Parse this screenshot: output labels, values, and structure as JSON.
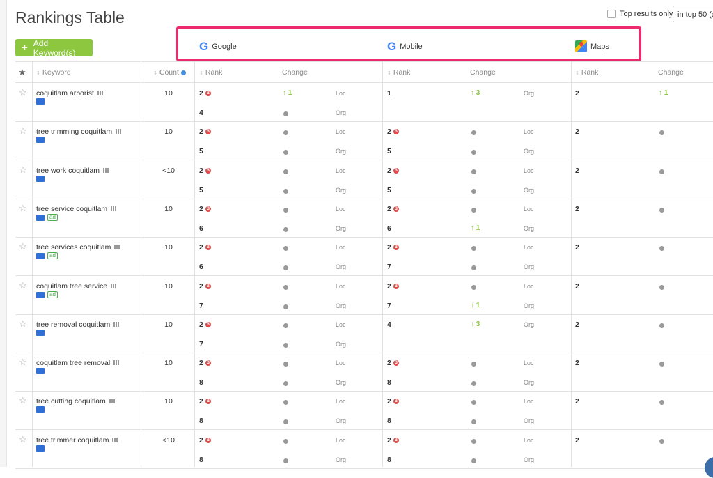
{
  "page": {
    "title": "Rankings Table",
    "top_results_label": "Top results only",
    "top_select_value": "in top 50 (al",
    "add_button_label": "Add Keyword(s)"
  },
  "engines": [
    {
      "name": "Google",
      "icon": "google-icon"
    },
    {
      "name": "Mobile",
      "icon": "google-icon"
    },
    {
      "name": "Maps",
      "icon": "google-maps-icon"
    }
  ],
  "headers": {
    "keyword": "Keyword",
    "count": "Count",
    "rank": "Rank",
    "change": "Change"
  },
  "colors": {
    "accent_green": "#8dc63f",
    "highlight": "#ee2a6e",
    "badge_red": "#e04b4b"
  },
  "rows": [
    {
      "keyword": "coquitlam arborist",
      "count": "10",
      "ad": "",
      "g_rank_loc": "2",
      "g_loc_badge": "B",
      "g_change_loc": "1",
      "g_type_loc": "Loc",
      "g_rank_org": "4",
      "g_type_org": "Org",
      "m_rank_1": "1",
      "m_change_1": "3",
      "m_type_1": "Org",
      "maps_rank": "2",
      "maps_change": "1"
    },
    {
      "keyword": "tree trimming coquitlam",
      "count": "10",
      "ad": "",
      "g_rank_loc": "2",
      "g_loc_badge": "B",
      "g_type_loc": "Loc",
      "g_rank_org": "5",
      "g_type_org": "Org",
      "m_rank_1": "2",
      "m_badge_1": "B",
      "m_type_1": "Loc",
      "m_rank_2": "5",
      "m_type_2": "Org",
      "maps_rank": "2"
    },
    {
      "keyword": "tree work coquitlam",
      "count": "<10",
      "ad": "",
      "g_rank_loc": "2",
      "g_loc_badge": "B",
      "g_type_loc": "Loc",
      "g_rank_org": "5",
      "g_type_org": "Org",
      "m_rank_1": "2",
      "m_badge_1": "B",
      "m_type_1": "Loc",
      "m_rank_2": "5",
      "m_type_2": "Org",
      "maps_rank": "2"
    },
    {
      "keyword": "tree service coquitlam",
      "count": "10",
      "ad": "ad",
      "g_rank_loc": "2",
      "g_loc_badge": "B",
      "g_type_loc": "Loc",
      "g_rank_org": "6",
      "g_type_org": "Org",
      "m_rank_1": "2",
      "m_badge_1": "B",
      "m_type_1": "Loc",
      "m_rank_2": "6",
      "m_change_2": "1",
      "m_type_2": "Org",
      "maps_rank": "2"
    },
    {
      "keyword": "tree services coquitlam",
      "count": "10",
      "ad": "ad",
      "g_rank_loc": "2",
      "g_loc_badge": "B",
      "g_type_loc": "Loc",
      "g_rank_org": "6",
      "g_type_org": "Org",
      "m_rank_1": "2",
      "m_badge_1": "B",
      "m_type_1": "Loc",
      "m_rank_2": "7",
      "m_type_2": "Org",
      "maps_rank": "2"
    },
    {
      "keyword": "coquitlam tree service",
      "count": "10",
      "ad": "ad",
      "g_rank_loc": "2",
      "g_loc_badge": "B",
      "g_type_loc": "Loc",
      "g_rank_org": "7",
      "g_type_org": "Org",
      "m_rank_1": "2",
      "m_badge_1": "B",
      "m_type_1": "Loc",
      "m_rank_2": "7",
      "m_change_2": "1",
      "m_type_2": "Org",
      "maps_rank": "2"
    },
    {
      "keyword": "tree removal coquitlam",
      "count": "10",
      "ad": "",
      "g_rank_loc": "2",
      "g_loc_badge": "B",
      "g_type_loc": "Loc",
      "g_rank_org": "7",
      "g_type_org": "Org",
      "m_rank_1": "4",
      "m_change_1": "3",
      "m_type_1": "Org",
      "maps_rank": "2"
    },
    {
      "keyword": "coquitlam tree removal",
      "count": "10",
      "ad": "",
      "g_rank_loc": "2",
      "g_loc_badge": "B",
      "g_type_loc": "Loc",
      "g_rank_org": "8",
      "g_type_org": "Org",
      "m_rank_1": "2",
      "m_badge_1": "B",
      "m_type_1": "Loc",
      "m_rank_2": "8",
      "m_type_2": "Org",
      "maps_rank": "2"
    },
    {
      "keyword": "tree cutting coquitlam",
      "count": "10",
      "ad": "",
      "g_rank_loc": "2",
      "g_loc_badge": "B",
      "g_type_loc": "Loc",
      "g_rank_org": "8",
      "g_type_org": "Org",
      "m_rank_1": "2",
      "m_badge_1": "B",
      "m_type_1": "Loc",
      "m_rank_2": "8",
      "m_type_2": "Org",
      "maps_rank": "2"
    },
    {
      "keyword": "tree trimmer coquitlam",
      "count": "<10",
      "ad": "",
      "g_rank_loc": "2",
      "g_loc_badge": "B",
      "g_type_loc": "Loc",
      "g_rank_org": "8",
      "g_type_org": "Org",
      "m_rank_1": "2",
      "m_badge_1": "B",
      "m_type_1": "Loc",
      "m_rank_2": "8",
      "m_type_2": "Org",
      "maps_rank": "2"
    }
  ]
}
